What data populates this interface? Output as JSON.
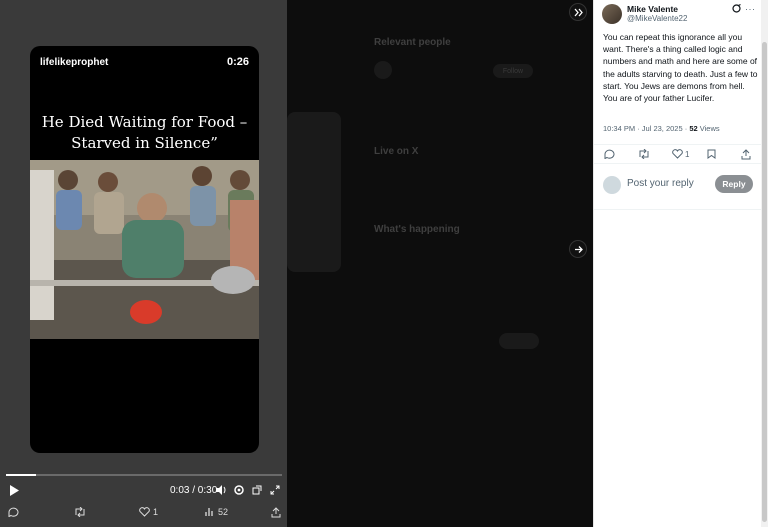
{
  "video": {
    "username": "lifelikeprophet",
    "duration": "0:26",
    "caption_line1": "He Died Waiting for Food –",
    "caption_line2": "Starved in Silence”",
    "progress_fraction": 0.11,
    "time_display": "0:03 / 0:30"
  },
  "media_actions": {
    "likes": "1",
    "views": "52"
  },
  "background_page": {
    "relevant_people_heading": "Relevant people",
    "live_heading": "Live on X",
    "happening_heading": "What's happening",
    "follow_label": "Follow"
  },
  "tweet": {
    "author_name": "Mike Valente",
    "author_handle": "@MikeValente22",
    "text": "You can repeat this ignorance all you want. There's a thing called logic and numbers and math and here are some of the adults starving to death. Just a few to start. You Jews are demons from hell. You are of your father Lucifer.",
    "timestamp": "10:34 PM · Jul 23, 2025 · ",
    "views_count": "52",
    "views_label": " Views",
    "likes": "1"
  },
  "reply": {
    "placeholder": "Post your reply",
    "button_label": "Reply"
  },
  "icons": [
    "play-icon",
    "volume-icon",
    "settings-icon",
    "popout-icon",
    "fullscreen-icon",
    "comment-icon",
    "retweet-icon",
    "heart-icon",
    "views-icon",
    "share-icon",
    "bookmark-icon",
    "grok-icon",
    "more-icon",
    "collapse-icon",
    "next-icon"
  ]
}
